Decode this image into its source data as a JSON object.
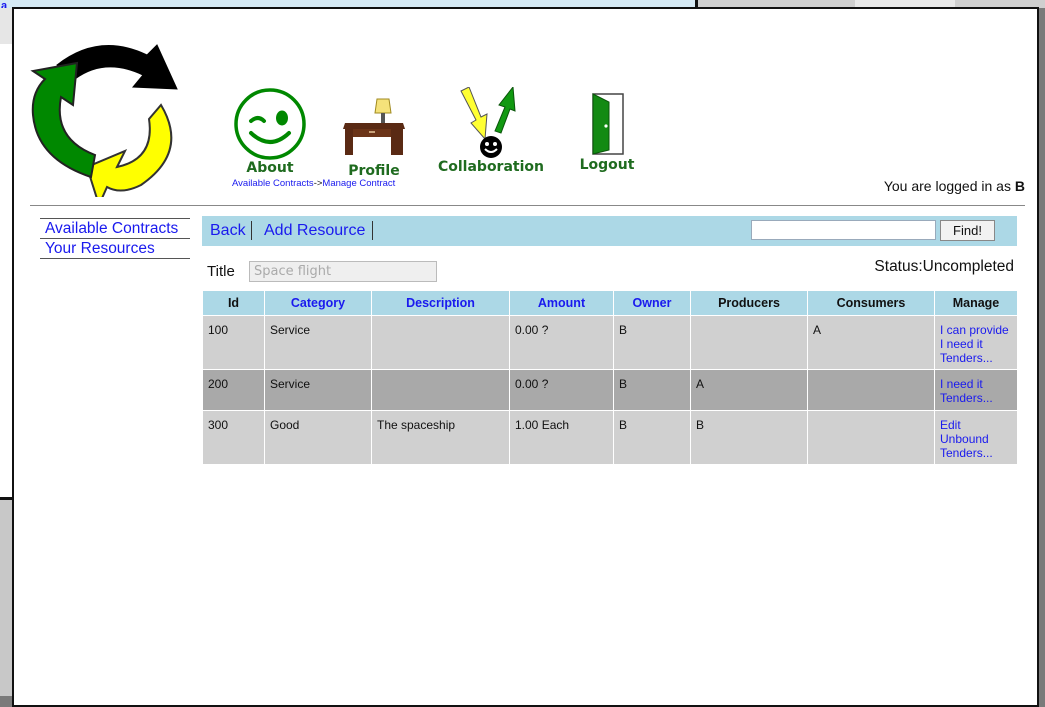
{
  "background_window": {
    "partial_text": "a"
  },
  "nav": {
    "about": "About",
    "profile": "Profile",
    "collaboration": "Collaboration",
    "logout": "Logout"
  },
  "breadcrumb": {
    "item1": "Available Contracts",
    "separator": "->",
    "item2": "Manage Contract"
  },
  "user": {
    "prefix": "You are logged in as",
    "name": "B"
  },
  "sidebar": {
    "items": [
      {
        "label": "Available Contracts"
      },
      {
        "label": "Your Resources"
      }
    ]
  },
  "toolbar": {
    "back": "Back",
    "add_resource": "Add Resource",
    "search_value": "",
    "find": "Find!"
  },
  "contract": {
    "title_label": "Title",
    "title_placeholder": "Space flight",
    "status_label": "Status:",
    "status_value": "Uncompleted"
  },
  "table": {
    "headers": [
      "Id",
      "Category",
      "Description",
      "Amount",
      "Owner",
      "Producers",
      "Consumers",
      "Manage"
    ],
    "rows": [
      {
        "id": "100",
        "category": "Service",
        "description": "",
        "amount": "0.00 ?",
        "owner": "B",
        "producers": "",
        "consumers": "A",
        "manage": [
          "I can provide",
          "I need it",
          "Tenders..."
        ]
      },
      {
        "id": "200",
        "category": "Service",
        "description": "",
        "amount": "0.00 ?",
        "owner": "B",
        "producers": "A",
        "consumers": "",
        "manage": [
          "I need it",
          "Tenders..."
        ]
      },
      {
        "id": "300",
        "category": "Good",
        "description": "The spaceship",
        "amount": "1.00 Each",
        "owner": "B",
        "producers": "B",
        "consumers": "",
        "manage": [
          "Edit",
          "Unbound",
          "Tenders..."
        ]
      }
    ]
  },
  "colors": {
    "header_bg": "#acd8e6",
    "link": "#1a1aee",
    "nav_text": "#1f6b1f",
    "row_light": "#d0d0d0",
    "row_dark": "#a9a9a9"
  },
  "icons": {
    "logo": "recycle-arrows-logo",
    "about": "winking-smiley-icon",
    "profile": "desk-with-lamp-icon",
    "collaboration": "collaboration-arrows-icon",
    "logout": "door-icon"
  }
}
